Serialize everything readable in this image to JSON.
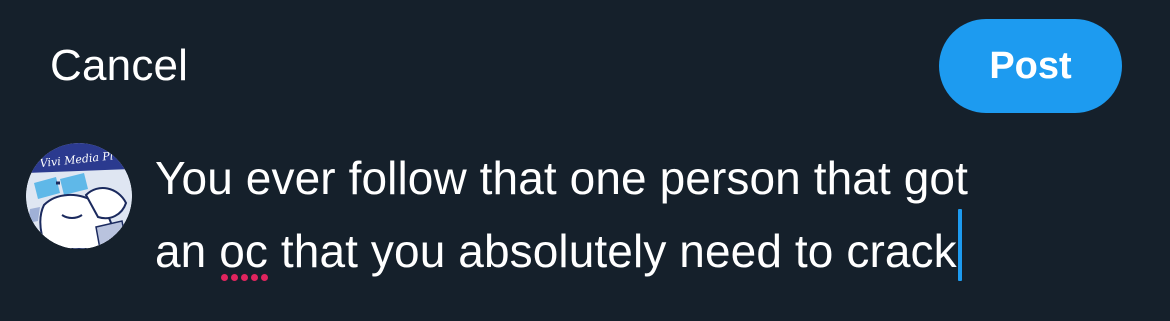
{
  "header": {
    "cancel_label": "Cancel",
    "post_label": "Post"
  },
  "composer": {
    "line1": "You ever follow that one person that got",
    "line2_before": "an ",
    "misspelled_word": "oc",
    "line2_after": " that you absolutely need to crack"
  },
  "avatar": {
    "banner_text": "Vivi Media Pl"
  },
  "colors": {
    "background": "#15202b",
    "accent": "#1d9bf0",
    "text": "#ffffff",
    "spellcheck": "#e0245e"
  }
}
